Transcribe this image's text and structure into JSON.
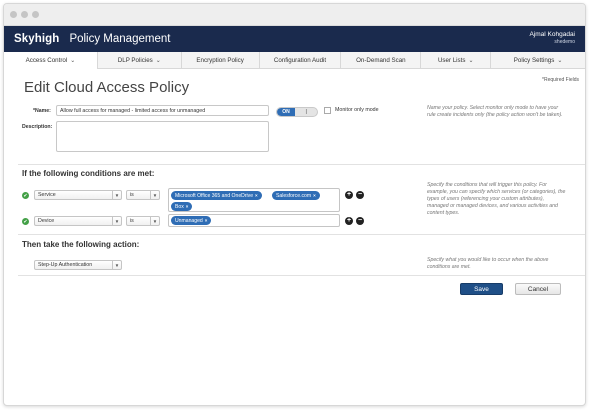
{
  "header": {
    "brand": "Skyhigh",
    "app_title": "Policy Management",
    "user_name": "Ajmal Kohgadai",
    "user_org": "shedemo"
  },
  "nav": {
    "items": [
      {
        "label": "Access Control",
        "dropdown": true
      },
      {
        "label": "DLP Policies",
        "dropdown": true
      },
      {
        "label": "Encryption Policy",
        "dropdown": false
      },
      {
        "label": "Configuration Audit",
        "dropdown": false
      },
      {
        "label": "On-Demand Scan",
        "dropdown": false
      },
      {
        "label": "User Lists",
        "dropdown": true
      },
      {
        "label": "Policy Settings",
        "dropdown": true
      }
    ]
  },
  "page": {
    "title": "Edit Cloud Access Policy",
    "required_note": "*Required Fields"
  },
  "form": {
    "name_label": "*Name:",
    "name_value": "Allow full access for managed - limited access for unmanaged",
    "description_label": "Description:",
    "toggle_label": "ON",
    "toggle_knob": "|||",
    "monitor_label": "Monitor only mode",
    "name_help": "Name your policy. Select monitor only mode to have your rule create incidents only (the policy action won't be taken)."
  },
  "conditions": {
    "title": "If the following conditions are met:",
    "help": "Specify the conditions that will trigger this policy. For example, you can specify which services (or categories), the types of users (referencing your custom attributes), managed or managed devices, and various activities and content types.",
    "rows": [
      {
        "field": "Service",
        "operator": "is",
        "values": [
          "Microsoft Office 365 and OneDrive",
          "Salesforce.com",
          "Box"
        ]
      },
      {
        "field": "Device",
        "operator": "is",
        "values": [
          "Unmanaged"
        ]
      }
    ],
    "check_icon": "✔",
    "arrow_icon": "▼",
    "remove_tag": "×",
    "add_symbol": "+",
    "remove_symbol": "−"
  },
  "action": {
    "title": "Then take the following action:",
    "selected": "Step-Up Authentication",
    "help": "Specify what you would like to occur when the above conditions are met."
  },
  "buttons": {
    "save": "Save",
    "cancel": "Cancel"
  }
}
